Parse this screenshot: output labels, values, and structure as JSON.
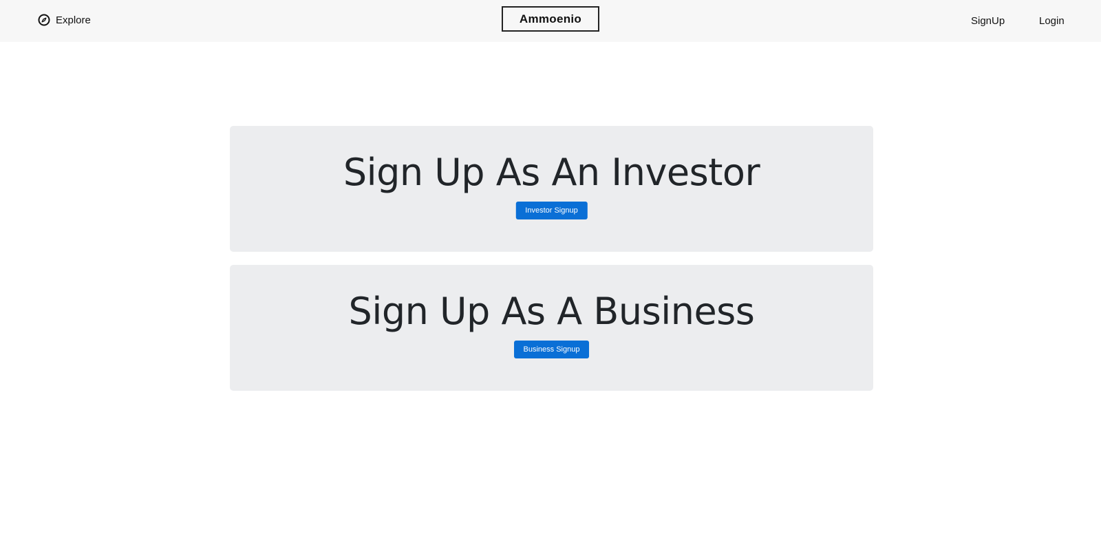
{
  "navbar": {
    "explore_label": "Explore",
    "brand": "Ammoenio",
    "signup_label": "SignUp",
    "login_label": "Login"
  },
  "cards": {
    "investor": {
      "title": "Sign Up As An Investor",
      "button_label": "Investor Signup"
    },
    "business": {
      "title": "Sign Up As A Business",
      "button_label": "Business Signup"
    }
  },
  "colors": {
    "navbar_bg": "#f7f7f7",
    "card_bg": "#ecedef",
    "button_bg": "#0a6fd6"
  },
  "icons": {
    "explore": "compass-icon"
  }
}
